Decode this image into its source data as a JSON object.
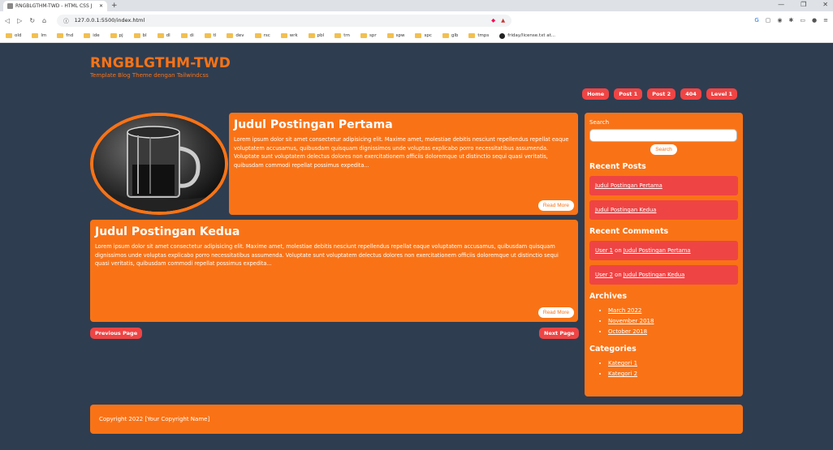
{
  "browser": {
    "tab_title": "RNGBLGTHM-TWD - HTML CSS J",
    "url": "127.0.0.1:5500/index.html",
    "bookmarks": [
      "old",
      "lm",
      "fnd",
      "ide",
      "pj",
      "bl",
      "dl",
      "di",
      "tl",
      "dev",
      "rsc",
      "wrk",
      "pbl",
      "trn",
      "spr",
      "spw",
      "spc",
      "glb",
      "tmps"
    ],
    "github_bookmark": "friday/license.txt at..."
  },
  "site": {
    "title": "RNGBLGTHM-TWD",
    "tagline": "Template Blog Theme dengan Tailwindcss"
  },
  "nav": [
    "Home",
    "Post 1",
    "Post 2",
    "404",
    "Level 1"
  ],
  "posts": [
    {
      "title": "Judul Postingan Pertama",
      "excerpt": "Lorem ipsum dolor sit amet consectetur adipisicing elit. Maxime amet, molestiae debitis nesciunt repellendus repellat eaque voluptatem accusamus, quibusdam quisquam dignissimos unde voluptas explicabo porro necessitatibus assumenda. Voluptate sunt voluptatem delectus dolores non exercitationem officiis doloremque ut distinctio sequi quasi veritatis, quibusdam commodi repellat possimus expedita...",
      "button": "Read More"
    },
    {
      "title": "Judul Postingan Kedua",
      "excerpt": "Lorem ipsum dolor sit amet consectetur adipisicing elit. Maxime amet, molestiae debitis nesciunt repellendus repellat eaque voluptatem accusamus, quibusdam quisquam dignissimos unde voluptas explicabo porro necessitatibus assumenda. Voluptate sunt voluptatem delectus dolores non exercitationem officiis doloremque ut distinctio sequi quasi veritatis, quibusdam commodi repellat possimus expedita...",
      "button": "Read More"
    }
  ],
  "pagination": {
    "prev": "Previous Page",
    "next": "Next Page"
  },
  "sidebar": {
    "search_label": "Search",
    "search_button": "Search",
    "recent_posts_title": "Recent Posts",
    "recent_posts": [
      "Judul Postingan Pertama",
      "Judul Postingan Kedua"
    ],
    "recent_comments_title": "Recent Comments",
    "comments": [
      {
        "user": "User 1",
        "on": "on",
        "post": "Judul Postingan Pertama"
      },
      {
        "user": "User 2",
        "on": "on",
        "post": "Judul Postingan Kedua"
      }
    ],
    "archives_title": "Archives",
    "archives": [
      "March 2022",
      "November 2018",
      "October 2018"
    ],
    "categories_title": "Categories",
    "categories": [
      "Kategori 1",
      "Kategori 2"
    ]
  },
  "footer": {
    "text": "Copyright 2022 [Your Copyright Name]"
  },
  "colors": {
    "background": "#2f3d51",
    "accent": "#f97316",
    "button": "#ef4444"
  }
}
